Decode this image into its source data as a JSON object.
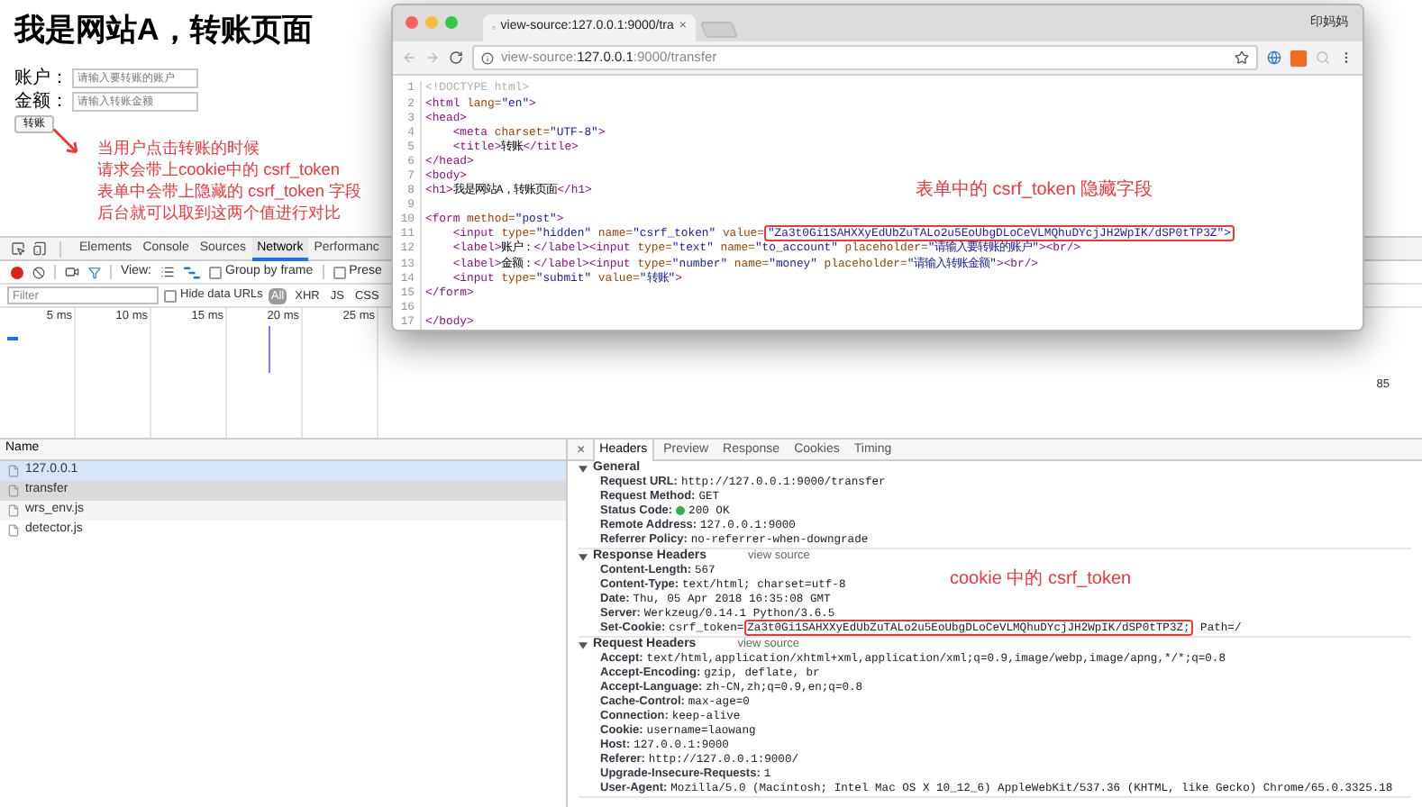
{
  "page": {
    "heading": "我是网站A，转账页面",
    "fields": [
      {
        "label": "账户：",
        "placeholder": "请输入要转账的账户"
      },
      {
        "label": "金额：",
        "placeholder": "请输入转账金额"
      }
    ],
    "submit": "转账",
    "annotation": [
      "当用户点击转账的时候",
      "请求会带上cookie中的 csrf_token",
      "表单中会带上隐藏的 csrf_token 字段",
      "后台就可以取到这两个值进行对比"
    ]
  },
  "devtools": {
    "panel_tabs": [
      {
        "label": "Elements",
        "selected": false
      },
      {
        "label": "Console",
        "selected": false
      },
      {
        "label": "Sources",
        "selected": false
      },
      {
        "label": "Network",
        "selected": true
      },
      {
        "label": "Performanc",
        "selected": false
      }
    ],
    "toolbar": {
      "recording": true,
      "view_label": "View:",
      "group_by_frame": {
        "label": "Group by frame",
        "checked": false
      },
      "preserve": {
        "label": "Prese",
        "checked": false
      }
    },
    "filter": {
      "placeholder": "Filter",
      "hide_data_urls": {
        "label": "Hide data URLs",
        "checked": false
      },
      "types": [
        {
          "label": "All",
          "selected": true
        },
        {
          "label": "XHR",
          "selected": false
        },
        {
          "label": "JS",
          "selected": false
        },
        {
          "label": "CSS",
          "selected": false
        }
      ]
    },
    "timeline": {
      "ticks": [
        "5 ms",
        "10 ms",
        "15 ms",
        "20 ms",
        "25 ms"
      ],
      "right_tick": "85"
    },
    "requests": {
      "header": "Name",
      "rows": [
        {
          "name": "127.0.0.1",
          "highlighted": true,
          "selected": false
        },
        {
          "name": "transfer",
          "highlighted": false,
          "selected": true
        },
        {
          "name": "wrs_env.js",
          "highlighted": false,
          "selected": false
        },
        {
          "name": "detector.js",
          "highlighted": false,
          "selected": false
        }
      ]
    },
    "detail": {
      "close": "×",
      "tabs": [
        {
          "label": "Headers",
          "selected": true
        },
        {
          "label": "Preview",
          "selected": false
        },
        {
          "label": "Response",
          "selected": false
        },
        {
          "label": "Cookies",
          "selected": false
        },
        {
          "label": "Timing",
          "selected": false
        }
      ],
      "sections": [
        {
          "title": "General",
          "expanded": true,
          "rows": [
            {
              "name": "Request URL:",
              "value": "http://127.0.0.1:9000/transfer"
            },
            {
              "name": "Request Method:",
              "value": "GET"
            },
            {
              "name": "Status Code:",
              "value": "200 OK",
              "color": "#2fb34a"
            },
            {
              "name": "Remote Address:",
              "value": "127.0.0.1:9000"
            },
            {
              "name": "Referrer Policy:",
              "value": "no-referrer-when-downgrade"
            }
          ]
        },
        {
          "title": "Response Headers",
          "view_source": "view source",
          "expanded": true,
          "rows": [
            {
              "name": "Content-Length:",
              "value": "567"
            },
            {
              "name": "Content-Type:",
              "value": "text/html; charset=utf-8"
            },
            {
              "name": "Date:",
              "value": "Thu, 05 Apr 2018 16:35:08 GMT"
            },
            {
              "name": "Server:",
              "value": "Werkzeug/0.14.1 Python/3.6.5"
            },
            {
              "name": "Set-Cookie:",
              "parts": [
                {
                  "text": "csrf_token=",
                  "boxed": false
                },
                {
                  "text": "Za3t0Gi1SAHXXyEdUbZuTALo2u5EoUbgDLoCeVLMQhuDYcjJH2WpIK/dSP0tTP3Z;",
                  "boxed": true
                },
                {
                  "text": " Path=/",
                  "boxed": false
                }
              ]
            }
          ]
        },
        {
          "title": "Request Headers",
          "view_source": "view source",
          "expanded": true,
          "rows": [
            {
              "name": "Accept:",
              "value": "text/html,application/xhtml+xml,application/xml;q=0.9,image/webp,image/apng,*/*;q=0.8"
            },
            {
              "name": "Accept-Encoding:",
              "value": "gzip, deflate, br"
            },
            {
              "name": "Accept-Language:",
              "value": "zh-CN,zh;q=0.9,en;q=0.8"
            },
            {
              "name": "Cache-Control:",
              "value": "max-age=0"
            },
            {
              "name": "Connection:",
              "value": "keep-alive"
            },
            {
              "name": "Cookie:",
              "value": "username=laowang"
            },
            {
              "name": "Host:",
              "value": "127.0.0.1:9000"
            },
            {
              "name": "Referer:",
              "value": "http://127.0.0.1:9000/"
            },
            {
              "name": "Upgrade-Insecure-Requests:",
              "value": "1"
            },
            {
              "name": "User-Agent:",
              "value": "Mozilla/5.0 (Macintosh; Intel Mac OS X 10_12_6) AppleWebKit/537.36 (KHTML, like Gecko) Chrome/65.0.3325.18"
            }
          ]
        }
      ],
      "annotation": "cookie 中的 csrf_token"
    }
  },
  "source_window": {
    "tab_title": "view-source:127.0.0.1:9000/tra",
    "tab_close": "×",
    "profile": "印妈妈",
    "address": {
      "prefix": "view-source:",
      "host": "127.0.0.1",
      "suffix": ":9000/transfer"
    },
    "annotation": "表单中的 csrf_token 隐藏字段",
    "lines": [
      {
        "number": "1",
        "tokens": [
          {
            "kind": "doctype",
            "text": "<!DOCTYPE html>"
          }
        ]
      },
      {
        "number": "2",
        "tokens": [
          {
            "kind": "tag",
            "text": "<html "
          },
          {
            "kind": "attr",
            "text": "lang="
          },
          {
            "kind": "value",
            "text": "\"en\""
          },
          {
            "kind": "tag",
            "text": ">"
          }
        ]
      },
      {
        "number": "3",
        "tokens": [
          {
            "kind": "tag",
            "text": "<head>"
          }
        ]
      },
      {
        "number": "4",
        "tokens": [
          {
            "kind": "tag",
            "text": "    <meta "
          },
          {
            "kind": "attr",
            "text": "charset="
          },
          {
            "kind": "value",
            "text": "\"UTF-8\""
          },
          {
            "kind": "tag",
            "text": ">"
          }
        ]
      },
      {
        "number": "5",
        "tokens": [
          {
            "kind": "tag",
            "text": "    <title>"
          },
          {
            "kind": "text",
            "text": "转账"
          },
          {
            "kind": "tag",
            "text": "</title>"
          }
        ]
      },
      {
        "number": "6",
        "tokens": [
          {
            "kind": "tag",
            "text": "</head>"
          }
        ]
      },
      {
        "number": "7",
        "tokens": [
          {
            "kind": "tag",
            "text": "<body>"
          }
        ]
      },
      {
        "number": "8",
        "tokens": [
          {
            "kind": "tag",
            "text": "<h1>"
          },
          {
            "kind": "text",
            "text": "我是网站A，转账页面"
          },
          {
            "kind": "tag",
            "text": "</h1>"
          }
        ]
      },
      {
        "number": "9"
      },
      {
        "number": "10",
        "tokens": [
          {
            "kind": "tag",
            "text": "<form "
          },
          {
            "kind": "attr",
            "text": "method="
          },
          {
            "kind": "value",
            "text": "\"post\""
          },
          {
            "kind": "tag",
            "text": ">"
          }
        ]
      },
      {
        "number": "11",
        "tokens": [
          {
            "kind": "tag",
            "text": "    <input "
          },
          {
            "kind": "attr",
            "text": "type="
          },
          {
            "kind": "value",
            "text": "\"hidden\""
          },
          {
            "kind": "attr",
            "text": " name="
          },
          {
            "kind": "value",
            "text": "\"csrf_token\""
          },
          {
            "kind": "attr",
            "text": " value="
          },
          {
            "kind": "value",
            "text": "\"Za3t0Gi1SAHXXyEdUbZuTALo2u5EoUbgDLoCeVLMQhuDYcjJH2WpIK/dSP0tTP3Z\">",
            "boxed": true
          }
        ]
      },
      {
        "number": "12",
        "tokens": [
          {
            "kind": "tag",
            "text": "    <label>"
          },
          {
            "kind": "text",
            "text": "账户："
          },
          {
            "kind": "tag",
            "text": "</label><input "
          },
          {
            "kind": "attr",
            "text": "type="
          },
          {
            "kind": "value",
            "text": "\"text\""
          },
          {
            "kind": "attr",
            "text": " name="
          },
          {
            "kind": "value",
            "text": "\"to_account\""
          },
          {
            "kind": "attr",
            "text": " placeholder="
          },
          {
            "kind": "value",
            "text": "\"请输入要转账的账户\""
          },
          {
            "kind": "tag",
            "text": "><br/>"
          }
        ]
      },
      {
        "number": "13",
        "tokens": [
          {
            "kind": "tag",
            "text": "    <label>"
          },
          {
            "kind": "text",
            "text": "金额："
          },
          {
            "kind": "tag",
            "text": "</label><input "
          },
          {
            "kind": "attr",
            "text": "type="
          },
          {
            "kind": "value",
            "text": "\"number\""
          },
          {
            "kind": "attr",
            "text": " name="
          },
          {
            "kind": "value",
            "text": "\"money\""
          },
          {
            "kind": "attr",
            "text": " placeholder="
          },
          {
            "kind": "value",
            "text": "\"请输入转账金额\""
          },
          {
            "kind": "tag",
            "text": "><br/>"
          }
        ]
      },
      {
        "number": "14",
        "tokens": [
          {
            "kind": "tag",
            "text": "    <input "
          },
          {
            "kind": "attr",
            "text": "type="
          },
          {
            "kind": "value",
            "text": "\"submit\""
          },
          {
            "kind": "attr",
            "text": " value="
          },
          {
            "kind": "value",
            "text": "\"转账\""
          },
          {
            "kind": "tag",
            "text": ">"
          }
        ]
      },
      {
        "number": "15",
        "tokens": [
          {
            "kind": "tag",
            "text": "</form>"
          }
        ]
      },
      {
        "number": "16"
      },
      {
        "number": "17",
        "tokens": [
          {
            "kind": "tag",
            "text": "</body>"
          }
        ]
      }
    ]
  }
}
